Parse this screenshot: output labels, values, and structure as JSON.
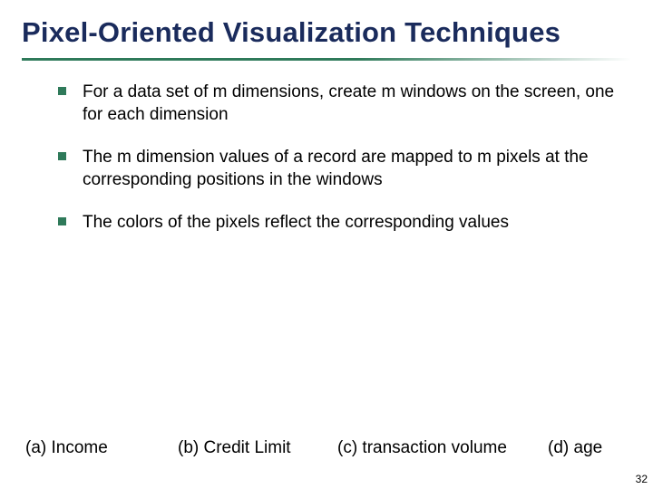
{
  "title": "Pixel-Oriented Visualization Techniques",
  "bullets": [
    "For a data set of m dimensions, create m windows on the screen, one for each dimension",
    "The m dimension values of a record are mapped to m pixels at the corresponding positions in the windows",
    "The colors of the pixels reflect the corresponding values"
  ],
  "captions": {
    "a": "(a) Income",
    "b": "(b) Credit Limit",
    "c": "(c) transaction volume",
    "d": "(d) age"
  },
  "page_number": "32"
}
